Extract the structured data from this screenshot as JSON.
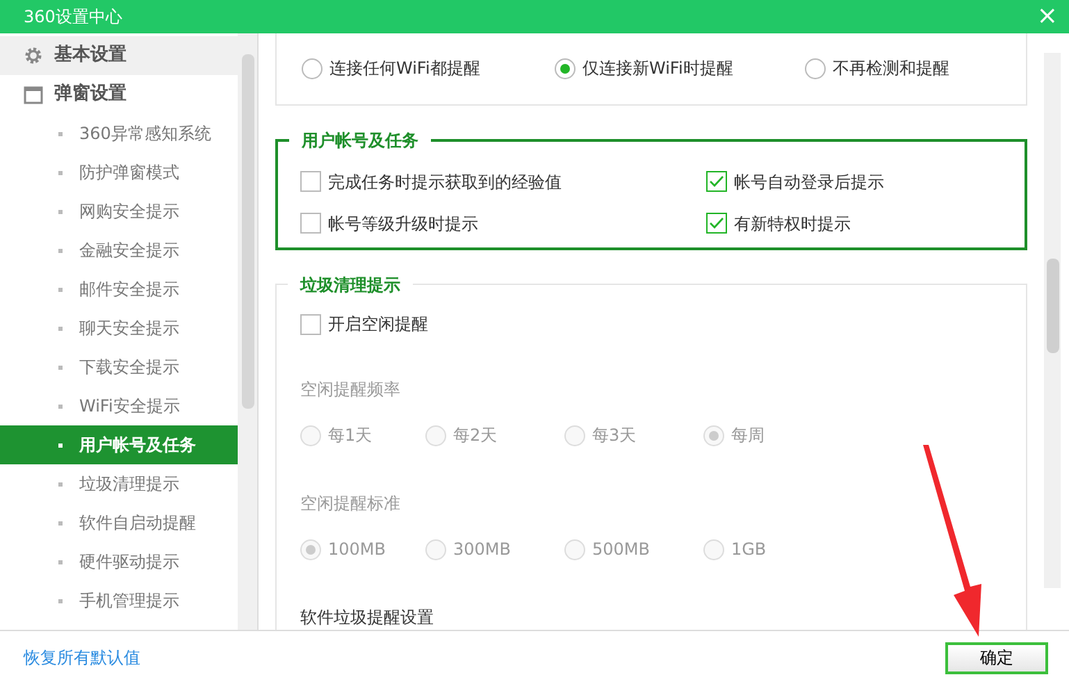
{
  "window": {
    "title": "360设置中心",
    "close": "×"
  },
  "sidebar": {
    "items": [
      {
        "label": "基本设置",
        "selected": false,
        "hovered": true
      },
      {
        "label": "弹窗设置",
        "selected": false,
        "hovered": false,
        "children": [
          {
            "label": "360异常感知系统",
            "selected": false
          },
          {
            "label": "防护弹窗模式",
            "selected": false
          },
          {
            "label": "网购安全提示",
            "selected": false
          },
          {
            "label": "金融安全提示",
            "selected": false
          },
          {
            "label": "邮件安全提示",
            "selected": false
          },
          {
            "label": "聊天安全提示",
            "selected": false
          },
          {
            "label": "下载安全提示",
            "selected": false
          },
          {
            "label": "WiFi安全提示",
            "selected": false
          },
          {
            "label": "用户帐号及任务",
            "selected": true
          },
          {
            "label": "垃圾清理提示",
            "selected": false
          },
          {
            "label": "软件自启动提醒",
            "selected": false
          },
          {
            "label": "硬件驱动提示",
            "selected": false
          },
          {
            "label": "手机管理提示",
            "selected": false
          }
        ]
      }
    ]
  },
  "wifi_section": {
    "options": [
      {
        "label": "连接任何WiFi都提醒",
        "selected": false
      },
      {
        "label": "仅连接新WiFi时提醒",
        "selected": true
      },
      {
        "label": "不再检测和提醒",
        "selected": false
      }
    ]
  },
  "account_section": {
    "title": "用户帐号及任务",
    "options": [
      {
        "label": "完成任务时提示获取到的经验值",
        "checked": false
      },
      {
        "label": "帐号自动登录后提示",
        "checked": true
      },
      {
        "label": "帐号等级升级时提示",
        "checked": false
      },
      {
        "label": "有新特权时提示",
        "checked": true
      }
    ]
  },
  "trash_section": {
    "title": "垃圾清理提示",
    "idle_reminder": {
      "label": "开启空闲提醒",
      "checked": false
    },
    "groups": [
      {
        "label": "空闲提醒频率",
        "disabled": true,
        "options": [
          {
            "label": "每1天",
            "selected": false
          },
          {
            "label": "每2天",
            "selected": false
          },
          {
            "label": "每3天",
            "selected": false
          },
          {
            "label": "每周",
            "selected": true
          }
        ]
      },
      {
        "label": "空闲提醒标准",
        "disabled": true,
        "options": [
          {
            "label": "100MB",
            "selected": true
          },
          {
            "label": "300MB",
            "selected": false
          },
          {
            "label": "500MB",
            "selected": false
          },
          {
            "label": "1GB",
            "selected": false
          }
        ]
      }
    ],
    "software_heading": "软件垃圾提醒设置"
  },
  "footer": {
    "restore_link": "恢复所有默认值",
    "ok_button": "确定"
  }
}
